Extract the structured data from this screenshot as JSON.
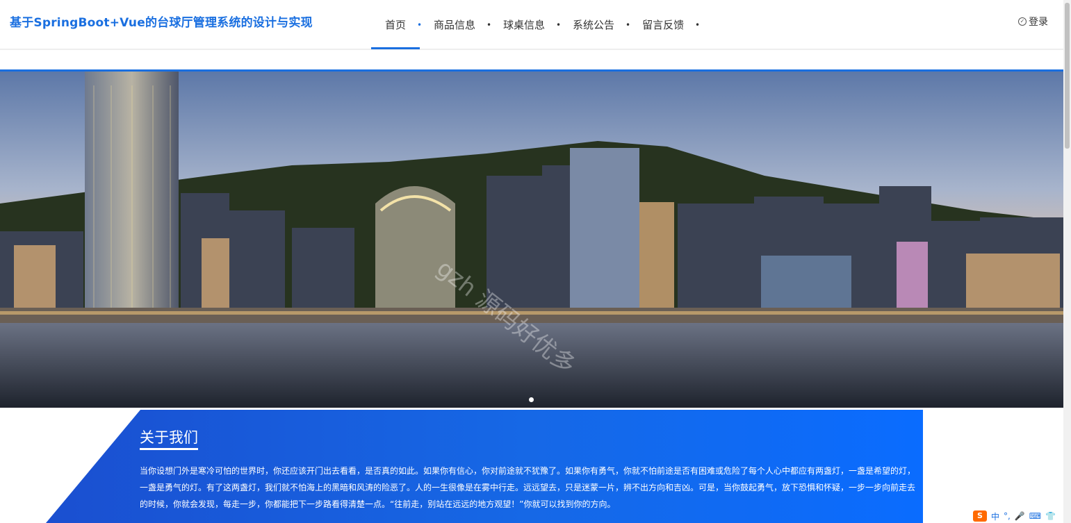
{
  "header": {
    "site_title": "基于SpringBoot+Vue的台球厅管理系统的设计与实现",
    "nav": [
      {
        "label": "首页",
        "active": true
      },
      {
        "label": "商品信息",
        "active": false
      },
      {
        "label": "球桌信息",
        "active": false
      },
      {
        "label": "系统公告",
        "active": false
      },
      {
        "label": "留言反馈",
        "active": false
      }
    ],
    "nav_dot": "•",
    "login_icon": "check-circle-icon",
    "login_label": "登录"
  },
  "banner": {
    "watermark": "gzh 源码好优多",
    "carousel_slides": 1,
    "active_slide": 1
  },
  "about": {
    "title": "关于我们",
    "text": "当你设想门外是寒冷可怕的世界时，你还应该开门出去看看，是否真的如此。如果你有信心，你对前途就不犹豫了。如果你有勇气，你就不怕前途是否有困难或危险了每个人心中都应有两盏灯，一盏是希望的灯，一盏是勇气的灯。有了这两盏灯，我们就不怕海上的黑暗和风涛的险恶了。人的一生很像是在雾中行走。远远望去，只是迷蒙一片，辨不出方向和吉凶。可是，当你鼓起勇气，放下恐惧和怀疑，一步一步向前走去的时候，你就会发现，每走一步，你都能把下一步路看得清楚一点。“往前走，别站在远远的地方观望！”你就可以找到你的方向。"
  },
  "tray": {
    "ime_icon": "sogou-ime-icon",
    "ime_glyph": "S",
    "ime_mode": "中",
    "ime_punct": "°,"
  },
  "colors": {
    "accent": "#1a6fe0",
    "about_bg": "#1668e6"
  }
}
